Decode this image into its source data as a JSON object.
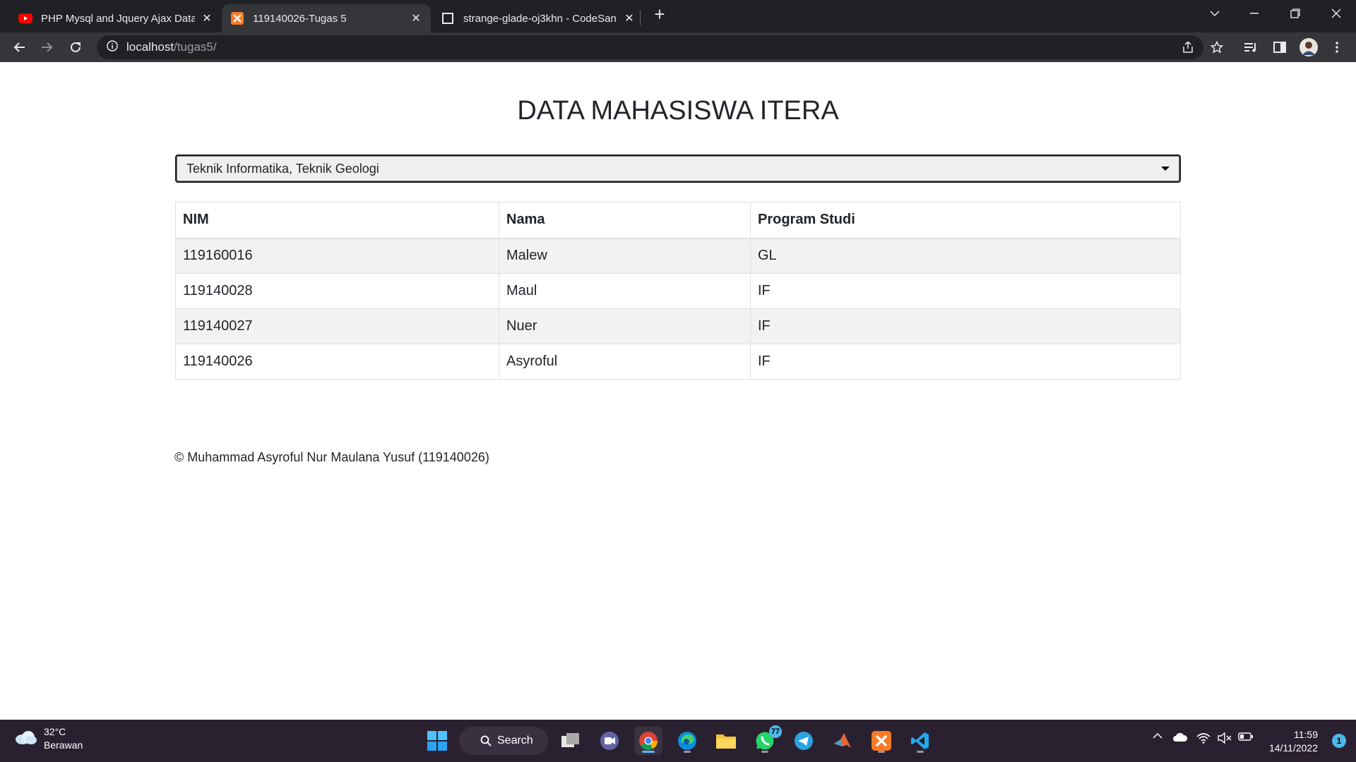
{
  "browser": {
    "tabs": [
      {
        "title": "PHP Mysql and Jquery Ajax Data",
        "icon": "youtube-icon",
        "active": false
      },
      {
        "title": "119140026-Tugas 5",
        "icon": "xampp-icon",
        "active": true
      },
      {
        "title": "strange-glade-oj3khn - CodeSan",
        "icon": "codesandbox-icon",
        "active": false
      }
    ],
    "address": {
      "host": "localhost",
      "path": "/tugas5/"
    }
  },
  "page": {
    "heading": "DATA MAHASISWA ITERA",
    "filter": {
      "selected": "Teknik Informatika, Teknik Geologi"
    },
    "table": {
      "headers": [
        "NIM",
        "Nama",
        "Program Studi"
      ],
      "rows": [
        [
          "119160016",
          "Malew",
          "GL"
        ],
        [
          "119140028",
          "Maul",
          "IF"
        ],
        [
          "119140027",
          "Nuer",
          "IF"
        ],
        [
          "119140026",
          "Asyroful",
          "IF"
        ]
      ]
    },
    "footer": "© Muhammad Asyroful Nur Maulana Yusuf (119140026)"
  },
  "taskbar": {
    "weather": {
      "temp": "32°C",
      "desc": "Berawan"
    },
    "search_label": "Search",
    "whatsapp_badge": "77",
    "clock": {
      "time": "11:59",
      "date": "14/11/2022"
    },
    "notification_count": "1"
  }
}
